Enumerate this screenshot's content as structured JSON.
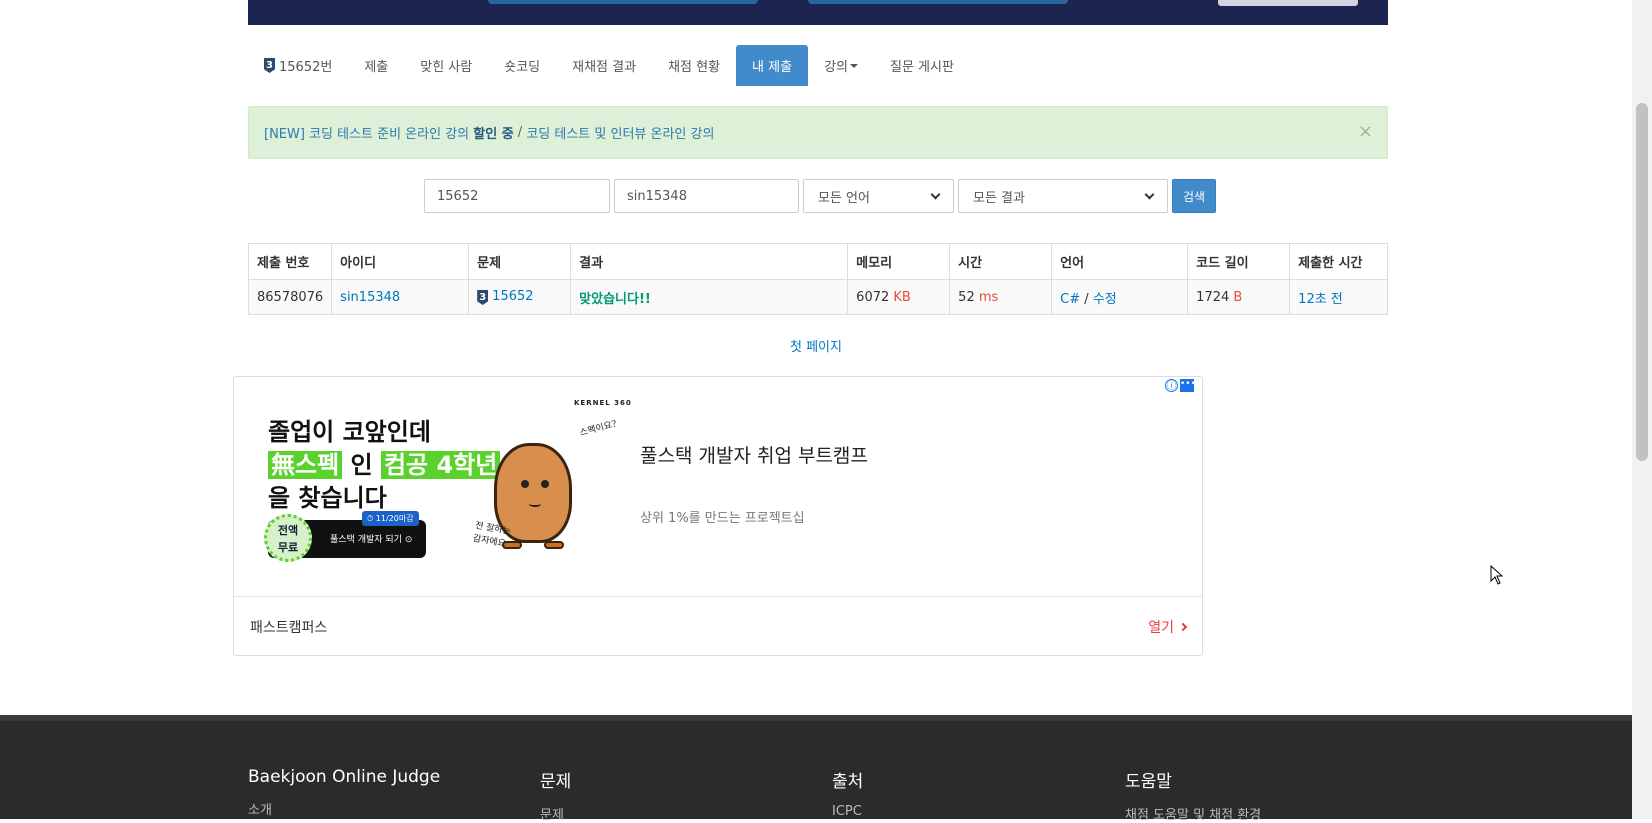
{
  "tabs": [
    {
      "label": "15652번",
      "badge": "3"
    },
    {
      "label": "제출"
    },
    {
      "label": "맞힌 사람"
    },
    {
      "label": "숏코딩"
    },
    {
      "label": "재채점 결과"
    },
    {
      "label": "채점 현황"
    },
    {
      "label": "내 제출",
      "active": true
    },
    {
      "label": "강의"
    },
    {
      "label": "질문 게시판"
    }
  ],
  "alert": {
    "prefix": "[NEW] 코딩 테스트 준비 온라인 강의 ",
    "bold": "할인 중",
    "sep": " / ",
    "suffix": "코딩 테스트 및 인터뷰 온라인 강의",
    "close": "×"
  },
  "search": {
    "problem_id": "15652",
    "user_id": "sin15348",
    "language": "모든 언어",
    "result": "모든 결과",
    "button": "검색"
  },
  "table": {
    "headers": [
      "제출 번호",
      "아이디",
      "문제",
      "결과",
      "메모리",
      "시간",
      "언어",
      "코드 길이",
      "제출한 시간"
    ],
    "row": {
      "submission_id": "86578076",
      "user": "sin15348",
      "problem_badge": "3",
      "problem": "15652",
      "result": "맞았습니다!!",
      "memory": "6072",
      "memory_unit": "KB",
      "time": "52",
      "time_unit": "ms",
      "language": "C#",
      "lang_sep": " / ",
      "edit": "수정",
      "code_length": "1724",
      "code_unit": "B",
      "submitted": "12초 전"
    }
  },
  "pagination": {
    "first": "첫 페이지"
  },
  "ad": {
    "info_icon": "ⓘ",
    "menu_icon": "•••",
    "kernel": "KERNEL 360",
    "line1": "졸업이 코앞인데",
    "line2a": "無스펙",
    "line2b": " 인 ",
    "line2c": "컴공 4학년",
    "line3": "을 찾습니다",
    "free": "전액\n무료",
    "pill_text": "풀스택 개발자 되기 ⊙",
    "tag": "⏱ 11/20마감",
    "scribble1": "스펙이요?",
    "scribble2": "전 잘하는\n감자에요",
    "title": "풀스택 개발자 취업 부트캠프",
    "subtitle": "상위 1%를 만드는 프로젝트십",
    "advertiser": "패스트캠퍼스",
    "open": "열기"
  },
  "footer": {
    "columns": [
      {
        "title": "Baekjoon Online Judge",
        "first_link": "소개"
      },
      {
        "title": "문제",
        "first_link": "문제"
      },
      {
        "title": "출처",
        "first_link": "ICPC"
      },
      {
        "title": "도움말",
        "first_link": "채점 도움말 및 채점 환경"
      }
    ]
  },
  "colors": {
    "accent": "#428bca",
    "success_text": "#009874",
    "link": "#0076c0",
    "unit_red": "#e74c3c",
    "footer_bg": "#2b2b2b"
  }
}
